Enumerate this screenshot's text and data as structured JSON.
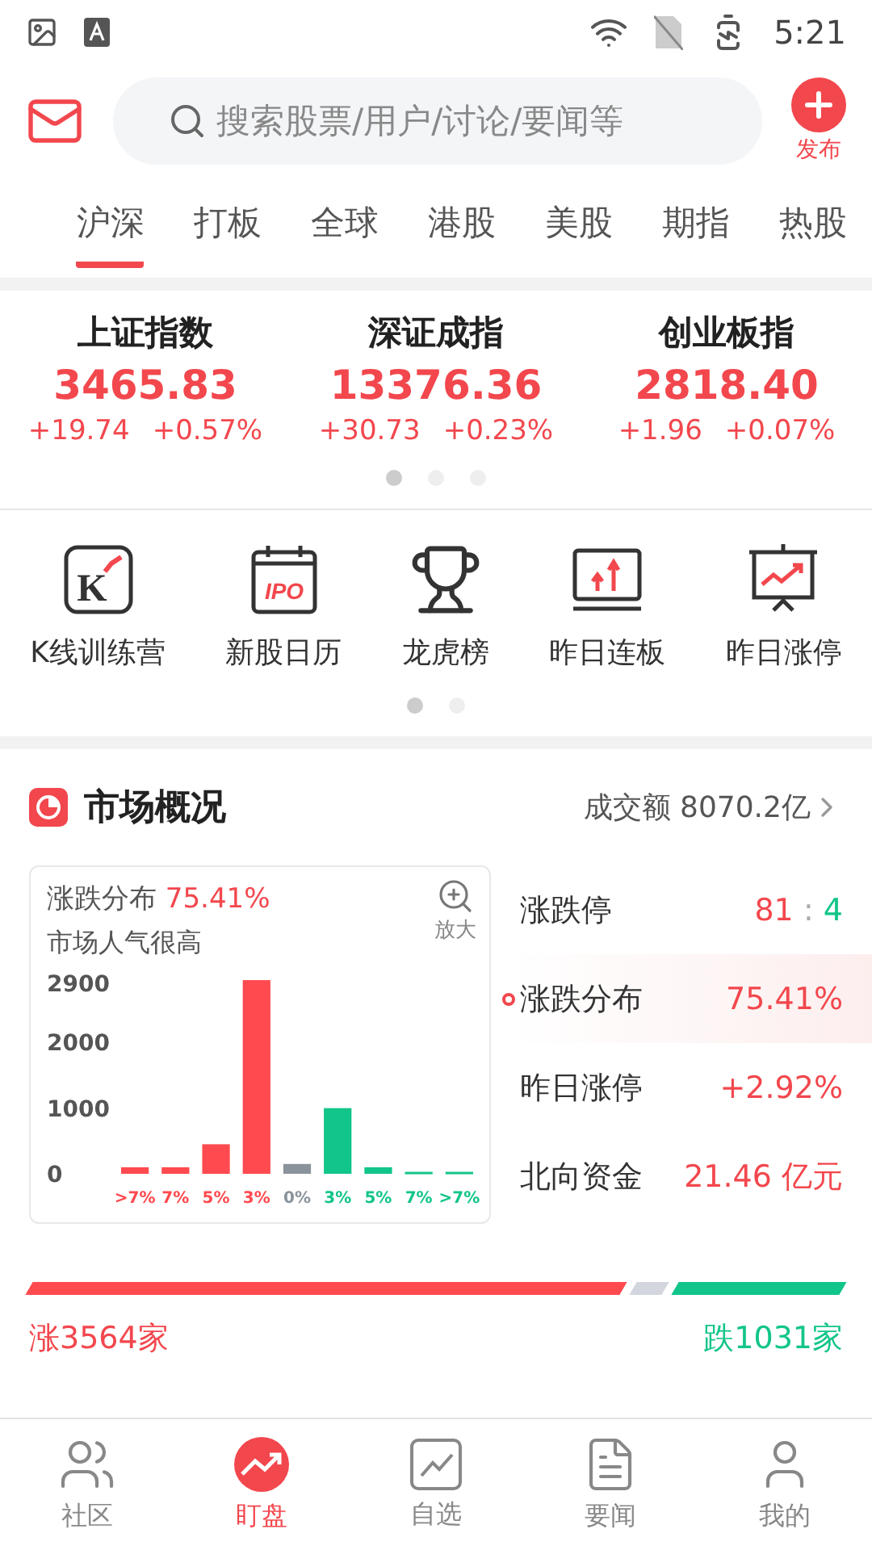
{
  "status_bar": {
    "time": "5:21"
  },
  "header": {
    "search": {
      "placeholder": "搜索股票/用户/讨论/要闻等"
    },
    "publish": {
      "label": "发布"
    }
  },
  "tabs": [
    {
      "label": "沪深",
      "selected": true
    },
    {
      "label": "打板",
      "selected": false
    },
    {
      "label": "全球",
      "selected": false
    },
    {
      "label": "港股",
      "selected": false
    },
    {
      "label": "美股",
      "selected": false
    },
    {
      "label": "期指",
      "selected": false
    },
    {
      "label": "热股",
      "selected": false
    }
  ],
  "indices": [
    {
      "name": "上证指数",
      "value": "3465.83",
      "change": "+19.74",
      "percent": "+0.57%"
    },
    {
      "name": "深证成指",
      "value": "13376.36",
      "change": "+30.73",
      "percent": "+0.23%"
    },
    {
      "name": "创业板指",
      "value": "2818.40",
      "change": "+1.96",
      "percent": "+0.07%"
    }
  ],
  "indices_pager": [
    {
      "selected": true
    },
    {
      "selected": false
    },
    {
      "selected": false
    }
  ],
  "shortcuts": [
    {
      "kind": "kline",
      "icon_text": "K",
      "label": "K线训练营"
    },
    {
      "kind": "calendar",
      "icon_text": "IPO",
      "label": "新股日历"
    },
    {
      "kind": "trophy",
      "label": "龙虎榜"
    },
    {
      "kind": "board",
      "label": "昨日连板"
    },
    {
      "kind": "easel",
      "label": "昨日涨停"
    }
  ],
  "shortcuts_pager": [
    {
      "selected": true
    },
    {
      "selected": false
    }
  ],
  "market": {
    "title": "市场概况",
    "turnover": "成交额 8070.2亿",
    "distribution": {
      "label": "涨跌分布",
      "percent": "75.41%",
      "mood": "市场人气很高",
      "zoom_label": "放大",
      "chart_data": {
        "type": "bar",
        "categories": [
          ">7%",
          "7%",
          "5%",
          "3%",
          "0%",
          "3%",
          "5%",
          "7%",
          ">7%"
        ],
        "ylim": [
          0,
          3000
        ],
        "yticks": [
          0,
          1000,
          2000,
          2900
        ],
        "series": [
          {
            "color": "#ff4a4f",
            "values": [
              100,
              100,
              450,
              2950,
              null,
              null,
              null,
              null,
              null
            ]
          },
          {
            "color": "#8a939c",
            "values": [
              null,
              null,
              null,
              null,
              150,
              null,
              null,
              null,
              null
            ]
          },
          {
            "color": "#12c58a",
            "values": [
              null,
              null,
              null,
              null,
              null,
              1000,
              100,
              30,
              30
            ]
          }
        ]
      }
    },
    "stats": [
      {
        "kind": "ratio",
        "label": "涨跌停",
        "up": "81",
        "separator": ":",
        "down": "4",
        "selected": false
      },
      {
        "kind": "value",
        "label": "涨跌分布",
        "value": "75.41%",
        "selected": true
      },
      {
        "kind": "value",
        "label": "昨日涨停",
        "value": "+2.92%",
        "selected": false
      },
      {
        "kind": "value",
        "label": "北向资金",
        "value": "21.46 亿元",
        "selected": false
      }
    ],
    "breadth": {
      "up_label": "涨3564家",
      "down_label": "跌1031家"
    }
  },
  "bottom_nav": [
    {
      "kind": "community",
      "label": "社区",
      "selected": false
    },
    {
      "kind": "watch",
      "label": "盯盘",
      "selected": true
    },
    {
      "kind": "chart",
      "label": "自选",
      "selected": false
    },
    {
      "kind": "news",
      "label": "要闻",
      "selected": false
    },
    {
      "kind": "me",
      "label": "我的",
      "selected": false
    }
  ]
}
